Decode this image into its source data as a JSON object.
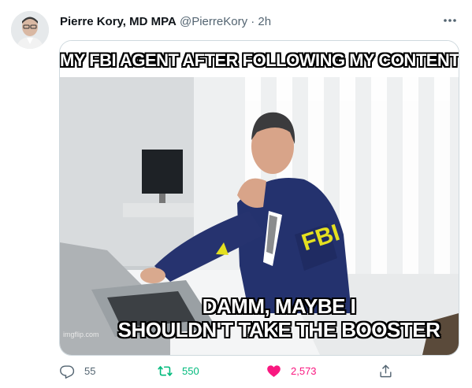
{
  "tweet": {
    "display_name": "Pierre Kory, MD MPA",
    "handle": "@PierreKory",
    "separator": "·",
    "time": "2h",
    "more_icon": "more-dots-icon"
  },
  "meme": {
    "top_caption": "MY FBI AGENT AFTER FOLLOWING MY CONTENT",
    "bottom_caption_line1": "DAMM, MAYBE I",
    "bottom_caption_line2": "SHOULDN'T TAKE THE BOOSTER",
    "jacket_text": "FBI",
    "watermark": "imgflip.com"
  },
  "actions": {
    "reply_count": "55",
    "retweet_count": "550",
    "like_count": "2,573",
    "reply_icon": "reply-icon",
    "retweet_icon": "retweet-icon",
    "like_icon": "heart-icon",
    "share_icon": "share-icon"
  },
  "colors": {
    "text": "#0f1419",
    "secondary": "#536471",
    "retweet": "#00ba7c",
    "like": "#f91880",
    "border": "#cfd9de"
  }
}
